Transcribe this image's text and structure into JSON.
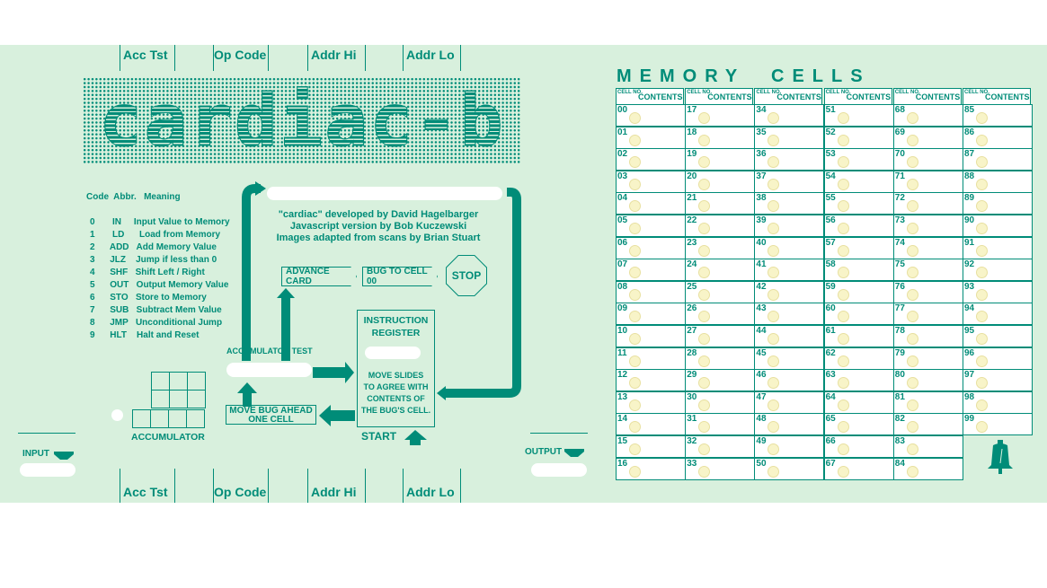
{
  "top_labels": [
    "Acc Tst",
    "Op Code",
    "Addr Hi",
    "Addr Lo"
  ],
  "bottom_labels": [
    "Acc Tst",
    "Op Code",
    "Addr Hi",
    "Addr Lo"
  ],
  "logo_text": "cardiac-b",
  "opcodes": {
    "header": "Code  Abbr.   Meaning",
    "rows": [
      "0       IN     Input Value to Memory",
      "1       LD      Load from Memory",
      "2      ADD   Add Memory Value",
      "3      JLZ    Jump if less than 0",
      "4      SHF   Shift Left / Right",
      "5      OUT   Output Memory Value",
      "6      STO   Store to Memory",
      "7      SUB   Subtract Mem Value",
      "8      JMP   Unconditional Jump",
      "9      HLT    Halt and Reset"
    ]
  },
  "credits": [
    "\"cardiac\" developed by David Hagelbarger",
    "Javascript version by Bob Kuczewski",
    "Images adapted from scans by Brian Stuart"
  ],
  "buttons": {
    "advance_card": "ADVANCE CARD",
    "bug_to_cell": "BUG TO CELL 00",
    "stop": "STOP",
    "start": "START",
    "move_bug_1": "MOVE BUG AHEAD",
    "move_bug_2": "ONE CELL"
  },
  "labels": {
    "accumulator_test": "ACCUMULATOR TEST",
    "accumulator": "ACCUMULATOR",
    "instruction_register_1": "INSTRUCTION",
    "instruction_register_2": "REGISTER",
    "slide_note": [
      "MOVE SLIDES",
      "TO AGREE WITH",
      "CONTENTS OF",
      "THE BUG'S CELL."
    ],
    "input": "INPUT",
    "output": "OUTPUT"
  },
  "memory": {
    "title": "MEMORY  CELLS",
    "cell_no_label": "CELL NO.",
    "contents_label": "CONTENTS",
    "columns": [
      [
        "00",
        "01",
        "02",
        "03",
        "04",
        "05",
        "06",
        "07",
        "08",
        "09",
        "10",
        "11",
        "12",
        "13",
        "14",
        "15",
        "16"
      ],
      [
        "17",
        "18",
        "19",
        "20",
        "21",
        "22",
        "23",
        "24",
        "25",
        "26",
        "27",
        "28",
        "29",
        "30",
        "31",
        "32",
        "33"
      ],
      [
        "34",
        "35",
        "36",
        "37",
        "38",
        "39",
        "40",
        "41",
        "42",
        "43",
        "44",
        "45",
        "46",
        "47",
        "48",
        "49",
        "50"
      ],
      [
        "51",
        "52",
        "53",
        "54",
        "55",
        "56",
        "57",
        "58",
        "59",
        "60",
        "61",
        "62",
        "63",
        "64",
        "65",
        "66",
        "67"
      ],
      [
        "68",
        "69",
        "70",
        "71",
        "72",
        "73",
        "74",
        "75",
        "76",
        "77",
        "78",
        "79",
        "80",
        "81",
        "82",
        "83",
        "84"
      ],
      [
        "85",
        "86",
        "87",
        "88",
        "89",
        "90",
        "91",
        "92",
        "93",
        "94",
        "95",
        "96",
        "97",
        "98",
        "99"
      ]
    ]
  },
  "colors": {
    "teal": "#008c78",
    "panel": "#d8f0dd",
    "oval": "#f8f4c8"
  }
}
